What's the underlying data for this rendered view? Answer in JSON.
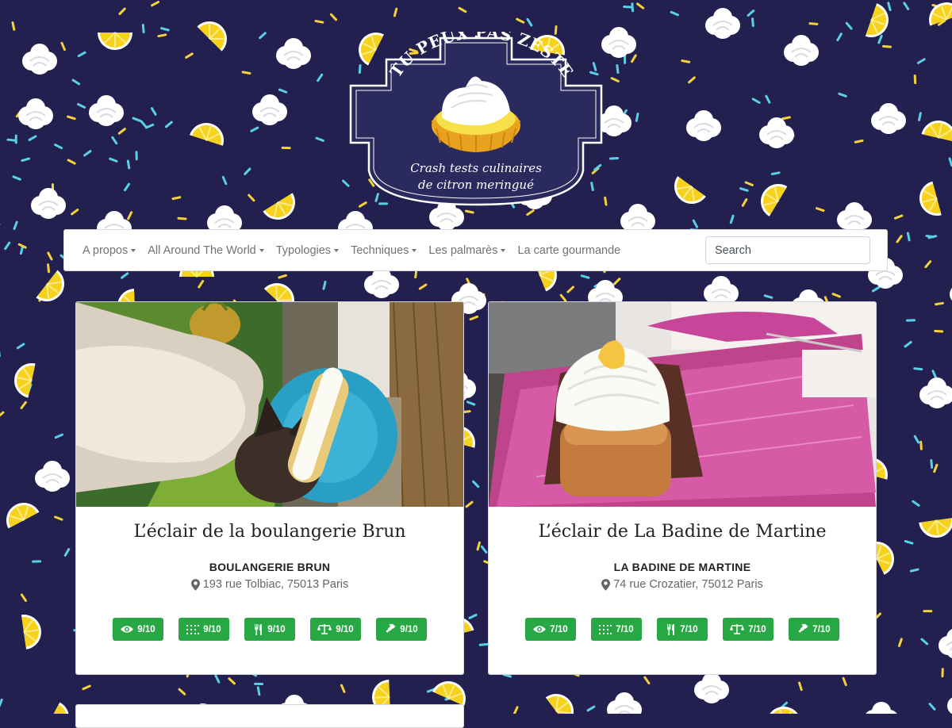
{
  "brand": {
    "name": "TU PEUX PAS ZESTE",
    "tagline_line1": "Crash tests culinaires",
    "tagline_line2": "de citron meringué"
  },
  "nav": {
    "items": [
      {
        "label": "A propos",
        "dropdown": true
      },
      {
        "label": "All Around The World",
        "dropdown": true
      },
      {
        "label": "Typologies",
        "dropdown": true
      },
      {
        "label": "Techniques",
        "dropdown": true
      },
      {
        "label": "Les palmarès",
        "dropdown": true
      },
      {
        "label": "La carte gourmande",
        "dropdown": false
      }
    ],
    "search_placeholder": "Search"
  },
  "cards": [
    {
      "title": "L’éclair de la boulangerie Brun",
      "shop": "BOULANGERIE BRUN",
      "address": "193 rue Tolbiac, 75013 Paris",
      "scores": [
        {
          "icon": "eye-icon",
          "value": "9/10"
        },
        {
          "icon": "texture-icon",
          "value": "9/10"
        },
        {
          "icon": "fork-knife-icon",
          "value": "9/10"
        },
        {
          "icon": "balance-scale-icon",
          "value": "9/10"
        },
        {
          "icon": "gavel-icon",
          "value": "9/10"
        }
      ]
    },
    {
      "title": "L’éclair de La Badine de Martine",
      "shop": "LA BADINE DE MARTINE",
      "address": "74 rue Crozatier, 75012 Paris",
      "scores": [
        {
          "icon": "eye-icon",
          "value": "7/10"
        },
        {
          "icon": "texture-icon",
          "value": "7/10"
        },
        {
          "icon": "fork-knife-icon",
          "value": "7/10"
        },
        {
          "icon": "balance-scale-icon",
          "value": "7/10"
        },
        {
          "icon": "gavel-icon",
          "value": "7/10"
        }
      ]
    }
  ],
  "colors": {
    "background": "#23204f",
    "badge": "#28a745",
    "lemon": "#f7d21c",
    "sprinkle_yellow": "#f4d23a",
    "sprinkle_blue": "#5ad0e8"
  }
}
